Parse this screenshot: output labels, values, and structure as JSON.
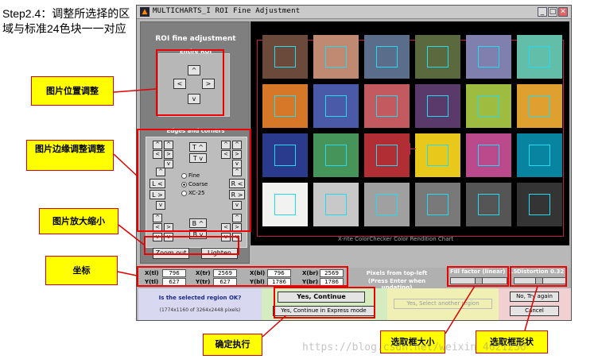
{
  "step_heading": "Step2.4：调整所选择的区域与标准24色块一一对应",
  "window": {
    "title": "MULTICHARTS_I ROI Fine Adjustment",
    "controls": [
      "_",
      "□",
      "✕"
    ]
  },
  "left_panel": {
    "title": "ROI fine adjustment",
    "entire_roi_label": "Entire ROI",
    "arrows": {
      "up": "^",
      "left": "<",
      "right": ">",
      "down": "v"
    },
    "edges_label": "Edges and corners",
    "edge_buttons": {
      "top_up": "T ^",
      "top_down": "T v",
      "left_left": "L <",
      "left_right": "L >",
      "right_left": "R <",
      "right_right": "R >",
      "bottom_up": "B ^",
      "bottom_down": "B v"
    },
    "radio": [
      {
        "label": "Fine",
        "checked": false
      },
      {
        "label": "Coarse",
        "checked": true
      },
      {
        "label": "XC-25",
        "checked": false
      }
    ],
    "zoom_out": "Zoom out",
    "lighten": "Lighten"
  },
  "image_caption": "X·rite ColorChecker Color Rendition Chart",
  "colors": {
    "patches": [
      "#6b4a3c",
      "#c08a72",
      "#5a6e8c",
      "#5a6a3e",
      "#8080ae",
      "#62bea8",
      "#d77828",
      "#4a5aa8",
      "#c25a60",
      "#5a3a6a",
      "#9ebc40",
      "#e0a030",
      "#2a3a8c",
      "#46945a",
      "#b02e34",
      "#e8c81a",
      "#ba4a8c",
      "#0883a0",
      "#f2f2f0",
      "#c8c8c8",
      "#a0a0a0",
      "#797979",
      "#555555",
      "#343434"
    ]
  },
  "coords": {
    "fields": [
      {
        "label": "X(tl)",
        "value": "796"
      },
      {
        "label": "Y(tl)",
        "value": "627"
      },
      {
        "label": "X(tr)",
        "value": "2569"
      },
      {
        "label": "Y(tr)",
        "value": "627"
      },
      {
        "label": "X(bl)",
        "value": "796"
      },
      {
        "label": "Y(bl)",
        "value": "1786"
      },
      {
        "label": "X(br)",
        "value": "2569"
      },
      {
        "label": "Y(br)",
        "value": "1786"
      }
    ],
    "pixels_note_1": "Pixels from top-left",
    "pixels_note_2": "(Press Enter when updating)",
    "fill_factor_label": "Fill factor (linear) 0.5",
    "fill_factor": 0.5,
    "distortion_label": "Distortion 0.32",
    "distortion": 0.32
  },
  "bottom": {
    "question": "Is the selected region OK?",
    "region_info": "(1774x1160 of 3264x2448 pixels)",
    "yes_continue": "Yes, Continue",
    "yes_express": "Yes, Continue in Express mode",
    "yes_select_another": "Yes, Select another region",
    "no_try_again": "No, Try again",
    "cancel": "Cancel"
  },
  "annotations": {
    "position": "图片位置调整",
    "edge": "图片边缘调整调整",
    "zoom": "图片放大缩小",
    "coords": "坐标",
    "confirm": "确定执行",
    "box_size": "选取框大小",
    "box_shape": "选取框形状"
  },
  "watermark": "https://blog.csdn.net/weixin_4621230"
}
